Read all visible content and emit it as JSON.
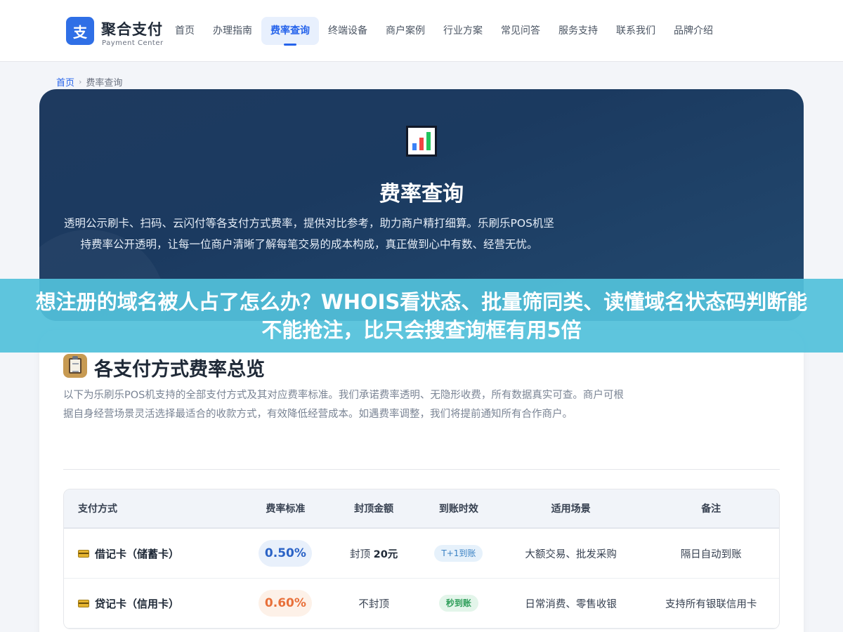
{
  "brand": {
    "logo_char": "支",
    "title": "聚合支付",
    "subtitle": "Payment Center"
  },
  "nav": {
    "items": [
      {
        "label": "首页"
      },
      {
        "label": "办理指南"
      },
      {
        "label": "费率查询"
      },
      {
        "label": "终端设备"
      },
      {
        "label": "商户案例"
      },
      {
        "label": "行业方案"
      },
      {
        "label": "常见问答"
      },
      {
        "label": "服务支持"
      },
      {
        "label": "联系我们"
      },
      {
        "label": "品牌介绍"
      }
    ],
    "active_index": 2
  },
  "breadcrumb": {
    "home": "首页",
    "separator": "›",
    "current": "费率查询"
  },
  "hero": {
    "icon": "bar-chart-icon",
    "title": "费率查询",
    "description": "透明公示刷卡、扫码、云闪付等各支付方式费率，提供对比参考，助力商户精打细算。乐刷乐POS机坚持费率公开透明，让每一位商户清晰了解每笔交易的成本构成，真正做到心中有数、经营无忧。"
  },
  "overlay": {
    "text": "想注册的域名被人占了怎么办？WHOIS看状态、批量筛同类、读懂域名状态码判断能不能抢注，比只会搜查询框有用5倍"
  },
  "section": {
    "icon": "clipboard-icon",
    "title": "各支付方式费率总览",
    "description": "以下为乐刷乐POS机支持的全部支付方式及其对应费率标准。我们承诺费率透明、无隐形收费，所有数据真实可查。商户可根据自身经营场景灵活选择最适合的收款方式，有效降低经营成本。如遇费率调整，我们将提前通知所有合作商户。"
  },
  "table": {
    "headers": [
      "支付方式",
      "费率标准",
      "封顶金额",
      "到账时效",
      "适用场景",
      "备注"
    ],
    "rows": [
      {
        "method": "借记卡（储蓄卡）",
        "rate": "0.50%",
        "cap_prefix": "封顶 ",
        "cap_value": "20元",
        "settlement": "T+1到账",
        "scenario": "大额交易、批发采购",
        "note": "隔日自动到账"
      },
      {
        "method": "贷记卡（信用卡）",
        "rate": "0.60%",
        "cap_prefix": "",
        "cap_value": "不封顶",
        "settlement": "秒到账",
        "scenario": "日常消费、零售收银",
        "note": "支持所有银联信用卡"
      }
    ]
  },
  "colors": {
    "accent": "#2563eb",
    "hero_bg": "#1e3a5f",
    "overlay_bg": "#52c1da",
    "rate_blue": "#2b63c6",
    "rate_orange": "#e8703a",
    "tag_green": "#2f9e5a"
  }
}
